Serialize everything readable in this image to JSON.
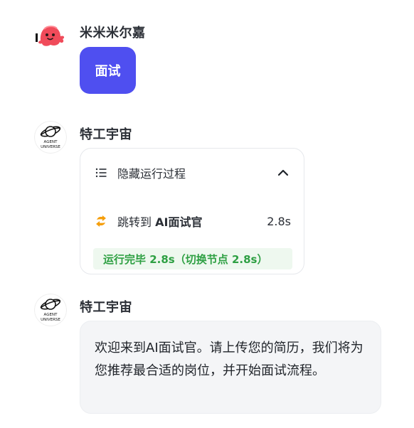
{
  "user": {
    "name": "米米米尔嘉",
    "message": "面试"
  },
  "agent_run": {
    "name": "特工宇宙",
    "toggle_label": "隐藏运行过程",
    "step_prefix": "跳转到",
    "step_target": "AI面试官",
    "step_time": "2.8s",
    "summary": "运行完毕 2.8s（切换节点 2.8s）"
  },
  "agent_reply": {
    "name": "特工宇宙",
    "message": "欢迎来到AI面试官。请上传您的简历，我们将为您推荐最合适的岗位，并开始面试流程。"
  },
  "avatar_text": {
    "line1": "AGENT",
    "line2": "UNIVERSE"
  },
  "colors": {
    "accent": "#4f4ff0",
    "success": "#2ea043",
    "success_bg": "#eef8ef",
    "step_icon": "#f59e0b"
  }
}
